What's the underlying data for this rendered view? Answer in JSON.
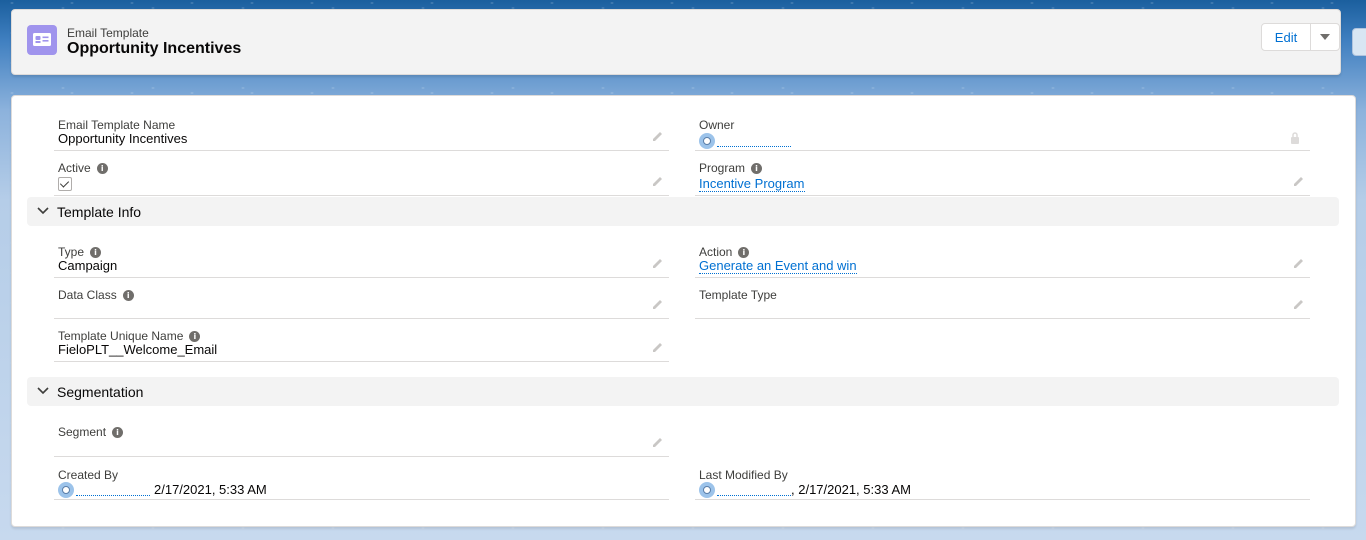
{
  "header": {
    "record_type": "Email Template",
    "record_name": "Opportunity Incentives",
    "edit_label": "Edit",
    "icon": "email-template-icon",
    "icon_color": "#a094ed"
  },
  "fields_top": {
    "template_name": {
      "label": "Email Template Name",
      "value": "Opportunity Incentives"
    },
    "owner": {
      "label": "Owner",
      "value": ""
    },
    "active": {
      "label": "Active",
      "checked": true
    },
    "program": {
      "label": "Program",
      "value": "Incentive Program"
    }
  },
  "template_info": {
    "title": "Template Info",
    "type": {
      "label": "Type",
      "value": "Campaign"
    },
    "action": {
      "label": "Action",
      "value": "Generate an Event and win"
    },
    "data_class": {
      "label": "Data Class",
      "value": ""
    },
    "template_type": {
      "label": "Template Type",
      "value": ""
    },
    "unique_name": {
      "label": "Template Unique Name",
      "value": "FieloPLT__Welcome_Email"
    }
  },
  "segmentation": {
    "title": "Segmentation",
    "segment": {
      "label": "Segment",
      "value": ""
    },
    "created_by": {
      "label": "Created By",
      "timestamp": "2/17/2021, 5:33 AM"
    },
    "last_modified_by": {
      "label": "Last Modified By",
      "timestamp": ", 2/17/2021, 5:33 AM"
    }
  },
  "colors": {
    "link": "#0070d2",
    "section_bg": "#f3f3f3"
  }
}
